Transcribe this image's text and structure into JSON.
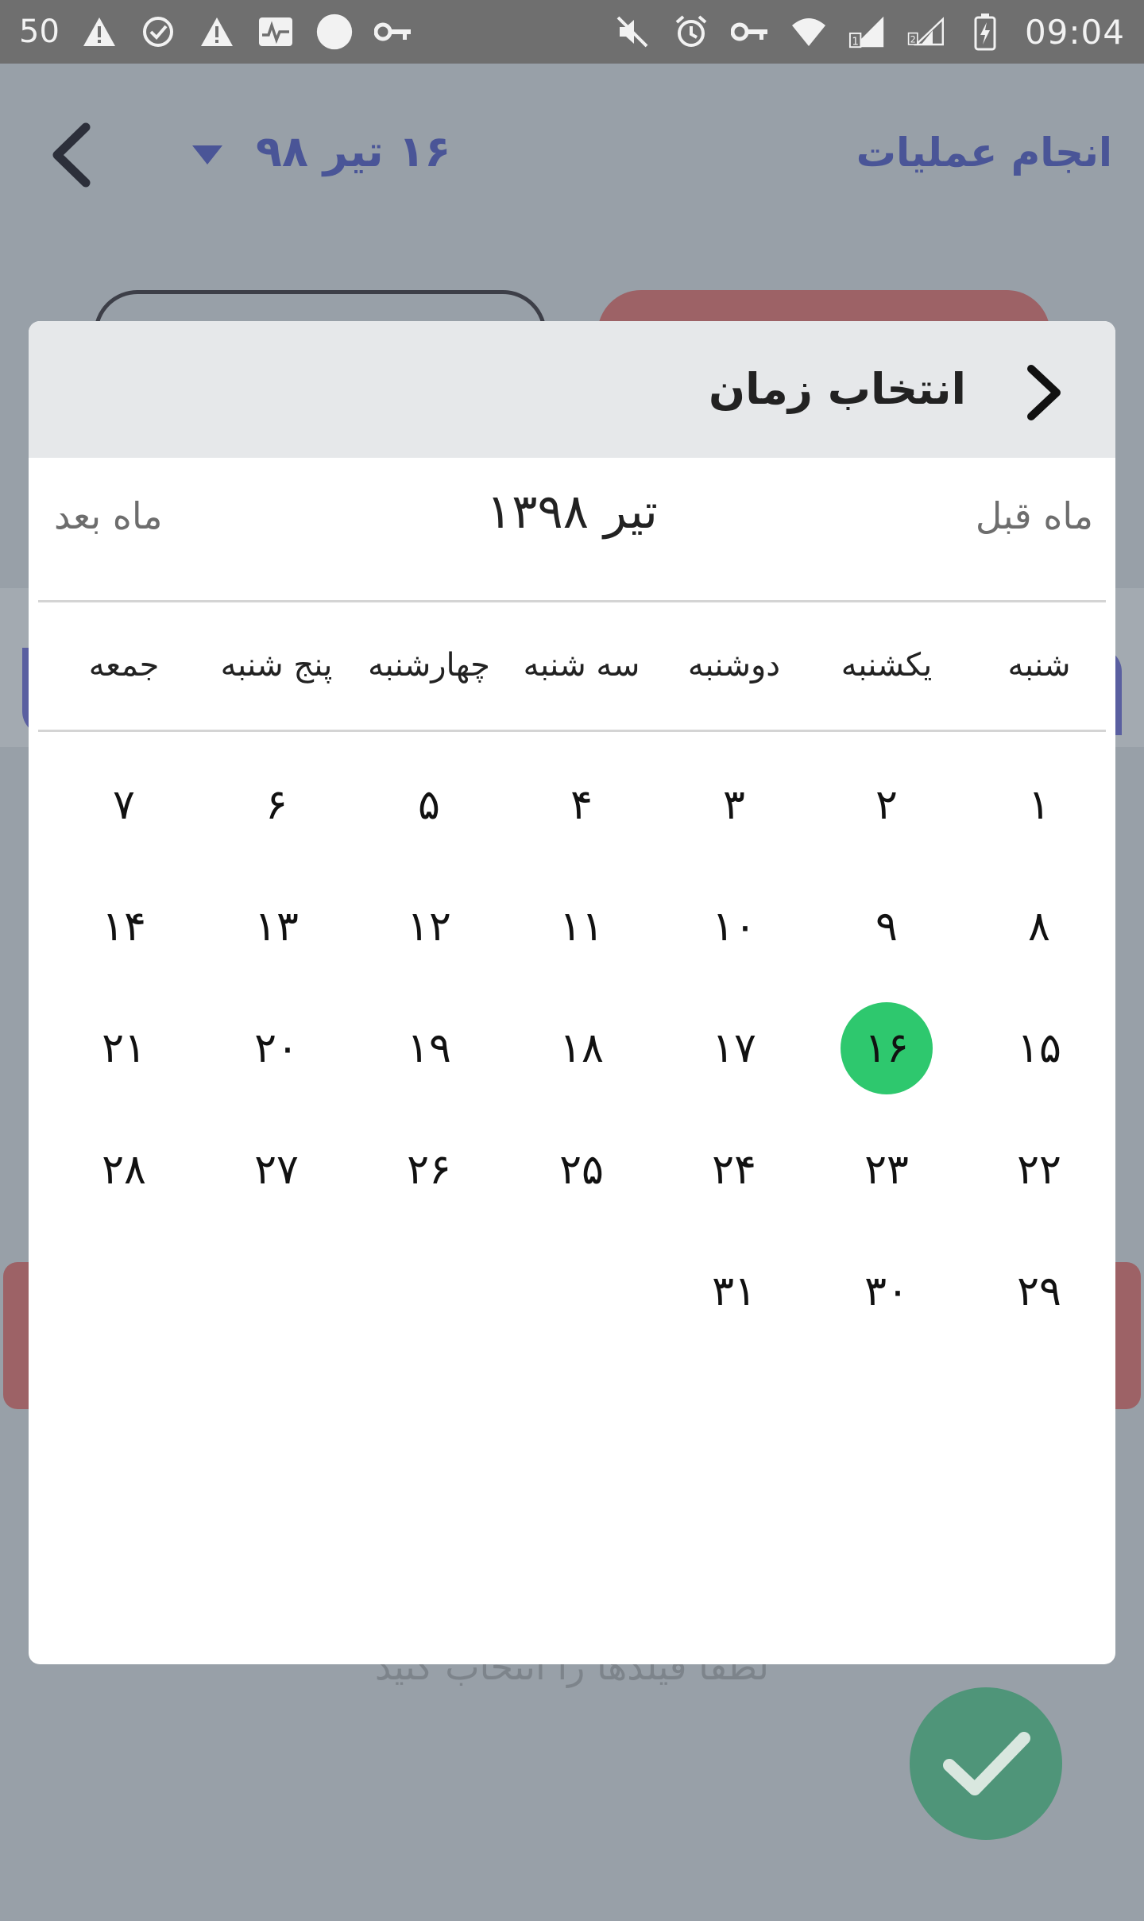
{
  "status_bar": {
    "left_number": "50",
    "left_icons": [
      "warning-icon",
      "check-badge-icon",
      "warning-icon",
      "activity-icon",
      "circle-icon",
      "key-icon"
    ],
    "right_icons": [
      "mute-icon",
      "alarm-icon",
      "key-icon",
      "wifi-icon",
      "signal-sim1-icon",
      "signal-sim2-icon",
      "battery-charging-icon"
    ],
    "time": "09:04"
  },
  "app": {
    "screen_title": "انجام عملیات",
    "date_title": "۱۶ تیر ۹۸",
    "hint": "لطفا فیلدها را انتخاب کنید"
  },
  "dialog": {
    "title": "انتخاب زمان",
    "month_title": "تیر ۱۳۹۸",
    "prev_month": "ماه قبل",
    "next_month": "ماه بعد",
    "weekdays": [
      "شنبه",
      "یکشنبه",
      "دوشنبه",
      "سه شنبه",
      "چهارشنبه",
      "پنج شنبه",
      "جمعه"
    ],
    "weeks": [
      [
        "۱",
        "۲",
        "۳",
        "۴",
        "۵",
        "۶",
        "۷"
      ],
      [
        "۸",
        "۹",
        "۱۰",
        "۱۱",
        "۱۲",
        "۱۳",
        "۱۴"
      ],
      [
        "۱۵",
        "۱۶",
        "۱۷",
        "۱۸",
        "۱۹",
        "۲۰",
        "۲۱"
      ],
      [
        "۲۲",
        "۲۳",
        "۲۴",
        "۲۵",
        "۲۶",
        "۲۷",
        "۲۸"
      ],
      [
        "۲۹",
        "۳۰",
        "۳۱",
        "",
        "",
        "",
        ""
      ]
    ],
    "selected_day": "۱۶"
  },
  "colors": {
    "accent": "#4a5597",
    "selected": "#2ec86e",
    "fab": "#4f9579"
  }
}
